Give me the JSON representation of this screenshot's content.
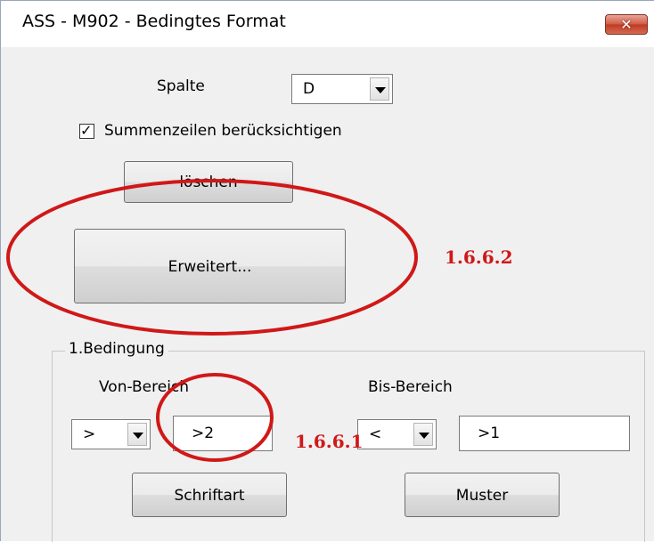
{
  "window": {
    "title": "ASS - M902 - Bedingtes Format",
    "close_symbol": "✕"
  },
  "spalte": {
    "label": "Spalte",
    "value": "D"
  },
  "summenzeilen": {
    "label": "Summenzeilen berücksichtigen",
    "checked": true
  },
  "buttons": {
    "loeschen": "löschen",
    "erweitert": "Erweitert...",
    "schriftart": "Schriftart",
    "muster": "Muster"
  },
  "bedingung": {
    "title": "1.Bedingung",
    "von_label": "Von-Bereich",
    "bis_label": "Bis-Bereich",
    "von_operator": ">",
    "von_value": ">2",
    "bis_operator": "<",
    "bis_value": ">1"
  },
  "annotations": {
    "erweitert_ref": "1.6.6.2",
    "von_ref": "1.6.6.1",
    "color": "#d01818"
  }
}
